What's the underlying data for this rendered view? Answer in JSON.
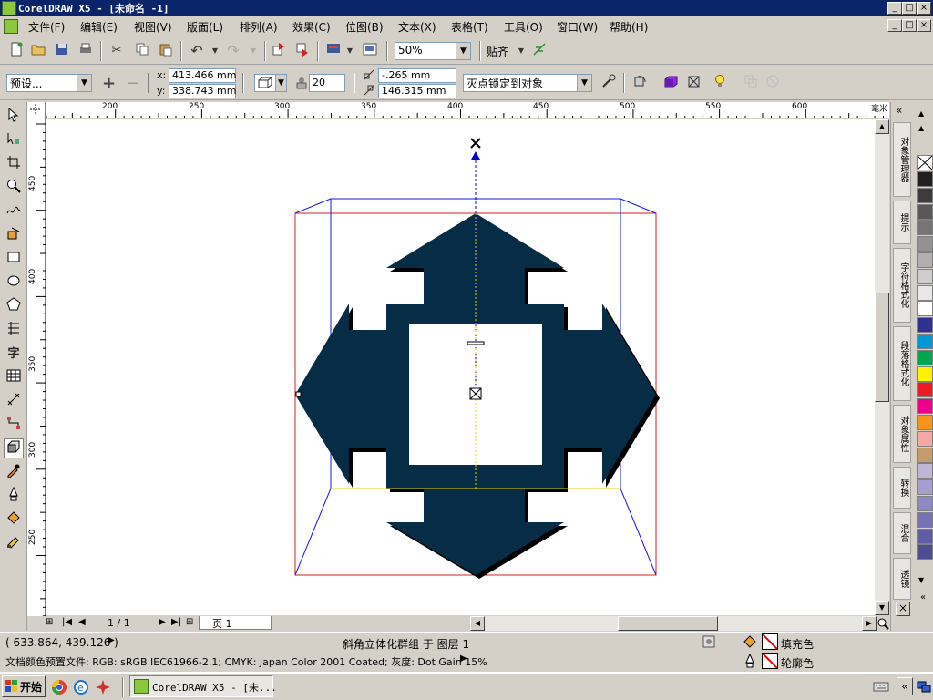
{
  "window": {
    "title": "CorelDRAW X5 - [未命名 -1]",
    "controls": [
      "_",
      "□",
      "×"
    ]
  },
  "menu": [
    "文件(F)",
    "编辑(E)",
    "视图(V)",
    "版面(L)",
    "排列(A)",
    "效果(C)",
    "位图(B)",
    "文本(X)",
    "表格(T)",
    "工具(O)",
    "窗口(W)",
    "帮助(H)"
  ],
  "toolbar": {
    "zoom_value": "50%",
    "snap_label": "贴齐"
  },
  "propbar": {
    "preset_value": "预设...",
    "x_label": "x:",
    "x_value": "413.466 mm",
    "y_label": "y:",
    "y_value": "338.743 mm",
    "depth_value": "20",
    "vp_x_value": "-.265 mm",
    "vp_y_value": "146.315 mm",
    "vp_lock_value": "灭点锁定到对象"
  },
  "ruler": {
    "top_labels": [
      "200",
      "250",
      "300",
      "350",
      "400",
      "450",
      "500",
      "550",
      "600"
    ],
    "top_unit": "毫米",
    "left_labels": [
      "450",
      "400",
      "350",
      "300",
      "250"
    ]
  },
  "docker_tabs": [
    "对象管理器",
    "提示",
    "字符格式化",
    "段落格式化",
    "对象属性",
    "转换",
    "混合",
    "透镜"
  ],
  "palette": {
    "colors": [
      "#231f20",
      "#3d3b3c",
      "#595758",
      "#767475",
      "#939192",
      "#b1afb0",
      "#cfcecf",
      "#e8e8e8",
      "#ffffff",
      "#2e3192",
      "#0099d8",
      "#00a651",
      "#fff200",
      "#ed1c24",
      "#ec008c",
      "#f7941d",
      "#f6a8a4",
      "#c69c6d",
      "#bfb5d6",
      "#a59fcf",
      "#8d89c3",
      "#7573b4",
      "#5d5ea3",
      "#4c4e8f"
    ]
  },
  "pagenav": {
    "page_count": "1 / 1",
    "page_tab": "页 1"
  },
  "status": {
    "coords": "( 633.864, 439.126 )",
    "object_info": "斜角立体化群组 于 图层 1",
    "color_profile": "文档颜色预置文件: RGB: sRGB IEC61966-2.1; CMYK: Japan Color 2001 Coated; 灰度: Dot Gain 15%",
    "fill_label": "填充色",
    "outline_label": "轮廓色"
  },
  "taskbar": {
    "start_label": "开始",
    "task_label": "CorelDRAW X5 - [未..."
  },
  "colors": {
    "shape_fill": "#062d45",
    "shape_shadow": "#000000",
    "bbox_red": "#d42020",
    "bbox_blue": "#1a1adb",
    "vanish_guide": "#0000cc",
    "center_guide": "#e8d000"
  }
}
